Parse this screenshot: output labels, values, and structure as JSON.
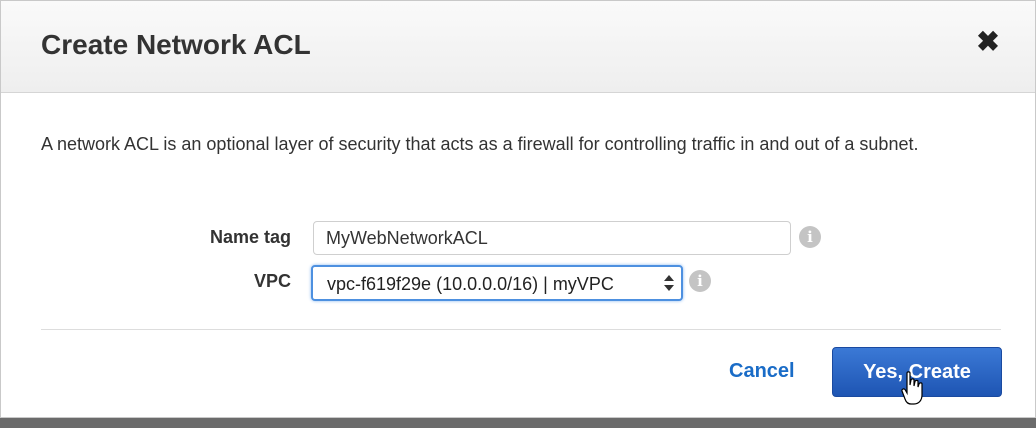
{
  "dialog": {
    "title": "Create Network ACL",
    "close_icon": "close-icon",
    "description": "A network ACL is an optional layer of security that acts as a firewall for controlling traffic in and out of a subnet."
  },
  "form": {
    "name_tag": {
      "label": "Name tag",
      "value": "MyWebNetworkACL",
      "info_icon": "info-icon"
    },
    "vpc": {
      "label": "VPC",
      "selected": "vpc-f619f29e (10.0.0.0/16) | myVPC",
      "info_icon": "info-icon"
    }
  },
  "actions": {
    "cancel_label": "Cancel",
    "create_label": "Yes, Create"
  },
  "colors": {
    "primary_button": "#2463c4",
    "link": "#1a6cc7",
    "focus_border": "#4d90e0"
  }
}
